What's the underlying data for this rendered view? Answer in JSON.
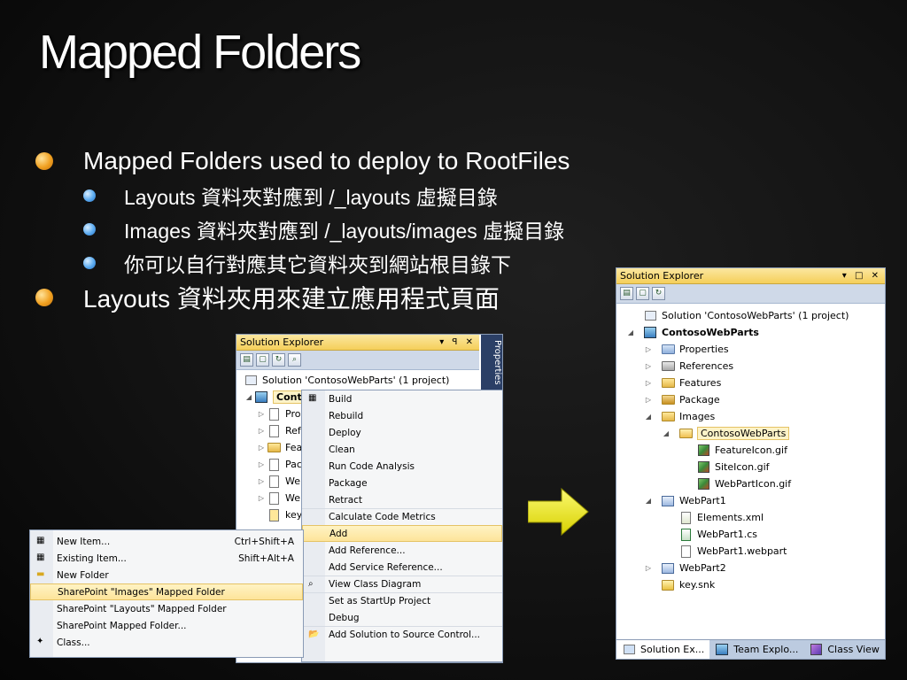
{
  "slide": {
    "title": "Mapped Folders",
    "bullets": [
      {
        "text": "Mapped Folders used to deploy to RootFiles",
        "sub": [
          "Layouts 資料夾對應到 /_layouts 虛擬目錄",
          "Images 資料夾對應到 /_layouts/images 虛擬目錄",
          "你可以自行對應其它資料夾到網站根目錄下"
        ]
      },
      {
        "text": "Layouts 資料夾用來建立應用程式頁面",
        "sub": []
      }
    ]
  },
  "left_explorer": {
    "title": "Solution Explorer",
    "controls": "▾ ꟼ ✕",
    "side_tab": "Properties",
    "solution": "Solution 'ContosoWebParts' (1 project)",
    "project": "Contoso WebParts",
    "items": [
      "Pro",
      "Ref",
      "Featu",
      "Pac",
      "We",
      "We",
      "key"
    ]
  },
  "context_menu": {
    "items": [
      {
        "label": "Build",
        "sep": false
      },
      {
        "label": "Rebuild",
        "sep": false
      },
      {
        "label": "Deploy",
        "sep": false
      },
      {
        "label": "Clean",
        "sep": false
      },
      {
        "label": "Run Code Analysis",
        "sep": false
      },
      {
        "label": "Package",
        "sep": false
      },
      {
        "label": "Retract",
        "sep": false
      },
      {
        "label": "Calculate Code Metrics",
        "sep": true
      },
      {
        "label": "Add",
        "sep": true,
        "highlight": true
      },
      {
        "label": "Add Reference...",
        "sep": false
      },
      {
        "label": "Add Service Reference...",
        "sep": false
      },
      {
        "label": "View Class Diagram",
        "sep": true
      },
      {
        "label": "Set as StartUp Project",
        "sep": true
      },
      {
        "label": "Debug",
        "sep": false
      },
      {
        "label": "Add Solution to Source Control...",
        "sep": true
      }
    ]
  },
  "add_submenu": {
    "items": [
      {
        "label": "New Item...",
        "shortcut": "Ctrl+Shift+A"
      },
      {
        "label": "Existing Item...",
        "shortcut": "Shift+Alt+A"
      },
      {
        "label": "New Folder",
        "shortcut": ""
      },
      {
        "label": "SharePoint \"Images\" Mapped Folder",
        "shortcut": "",
        "highlight": true
      },
      {
        "label": "SharePoint \"Layouts\" Mapped Folder",
        "shortcut": ""
      },
      {
        "label": "SharePoint Mapped Folder...",
        "shortcut": ""
      },
      {
        "label": "Class...",
        "shortcut": ""
      }
    ]
  },
  "right_explorer": {
    "title": "Solution Explorer",
    "controls": "▾ □ ✕",
    "tree": [
      {
        "label": "Solution 'ContosoWebParts' (1 project)",
        "level": 0,
        "icon": "solution",
        "exp": ""
      },
      {
        "label": "ContosoWebParts",
        "level": 0,
        "icon": "project",
        "exp": "◢",
        "bold": true
      },
      {
        "label": "Properties",
        "level": 1,
        "icon": "properties",
        "exp": "▷"
      },
      {
        "label": "References",
        "level": 1,
        "icon": "references",
        "exp": "▷"
      },
      {
        "label": "Features",
        "level": 1,
        "icon": "folder",
        "exp": "▷"
      },
      {
        "label": "Package",
        "level": 1,
        "icon": "package",
        "exp": "▷"
      },
      {
        "label": "Images",
        "level": 1,
        "icon": "folder",
        "exp": "◢"
      },
      {
        "label": "ContosoWebParts",
        "level": 2,
        "icon": "folder-open",
        "exp": "◢",
        "selected": true
      },
      {
        "label": "FeatureIcon.gif",
        "level": 3,
        "icon": "image",
        "exp": ""
      },
      {
        "label": "SiteIcon.gif",
        "level": 3,
        "icon": "image",
        "exp": ""
      },
      {
        "label": "WebPartIcon.gif",
        "level": 3,
        "icon": "image",
        "exp": ""
      },
      {
        "label": "WebPart1",
        "level": 1,
        "icon": "webpart",
        "exp": "◢"
      },
      {
        "label": "Elements.xml",
        "level": 2,
        "icon": "xml",
        "exp": ""
      },
      {
        "label": "WebPart1.cs",
        "level": 2,
        "icon": "cs",
        "exp": ""
      },
      {
        "label": "WebPart1.webpart",
        "level": 2,
        "icon": "file",
        "exp": ""
      },
      {
        "label": "WebPart2",
        "level": 1,
        "icon": "webpart",
        "exp": "▷"
      },
      {
        "label": "key.snk",
        "level": 1,
        "icon": "key",
        "exp": ""
      }
    ],
    "tabs": [
      "Solution Ex...",
      "Team Explo...",
      "Class View"
    ]
  },
  "colors": {
    "accent_orange": "#f0a020",
    "accent_blue": "#5aaaf0",
    "arrow_yellow": "#f2ee10"
  }
}
